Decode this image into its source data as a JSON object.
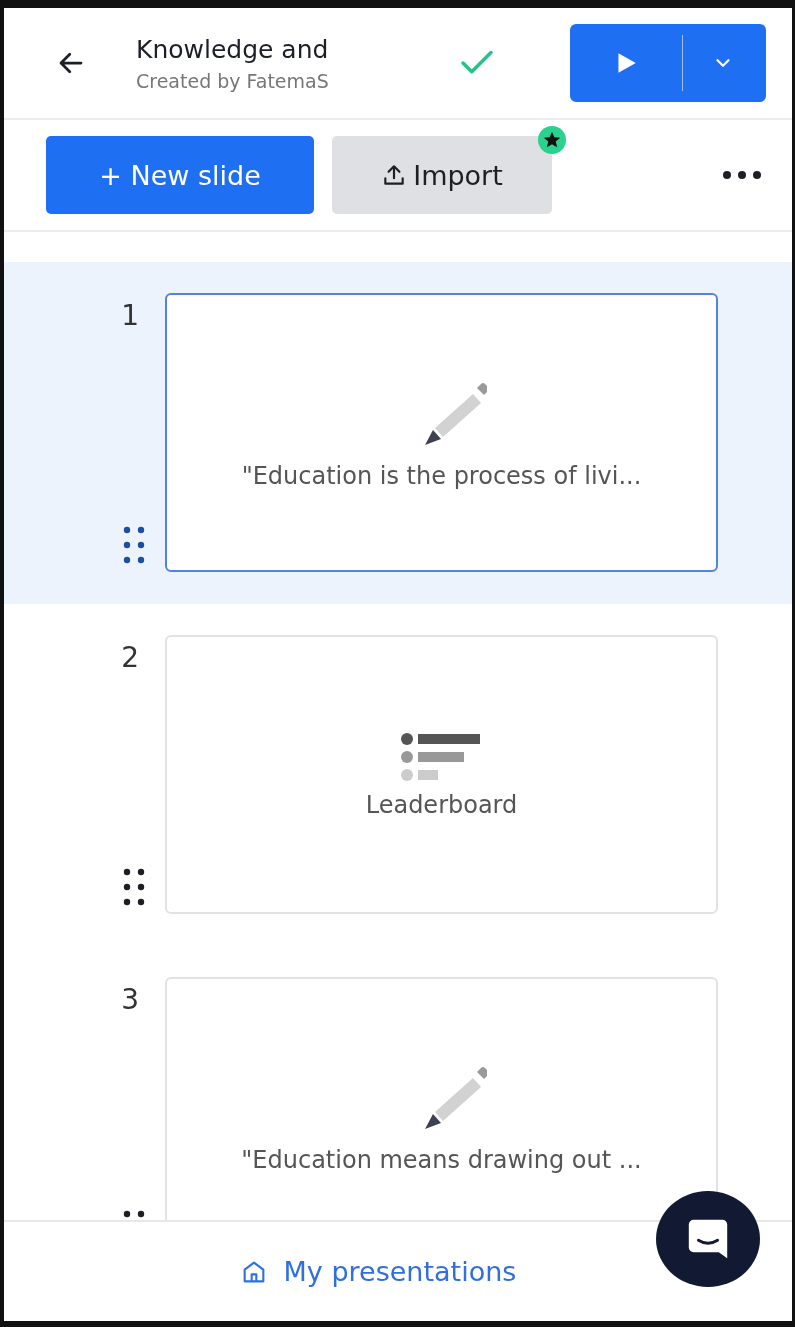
{
  "header": {
    "title": "Knowledge and",
    "subtitle": "Created by FatemaS",
    "saved": true
  },
  "toolbar": {
    "new_slide": "+ New slide",
    "import": "Import",
    "import_badge": true
  },
  "slides": [
    {
      "number": "1",
      "kind": "text",
      "caption": "\"Education is the process of livi...",
      "selected": true
    },
    {
      "number": "2",
      "kind": "leaderboard",
      "caption": "Leaderboard",
      "selected": false
    },
    {
      "number": "3",
      "kind": "text",
      "caption": "\"Education means drawing out ...",
      "selected": false
    }
  ],
  "footer": {
    "link": "My presentations"
  }
}
